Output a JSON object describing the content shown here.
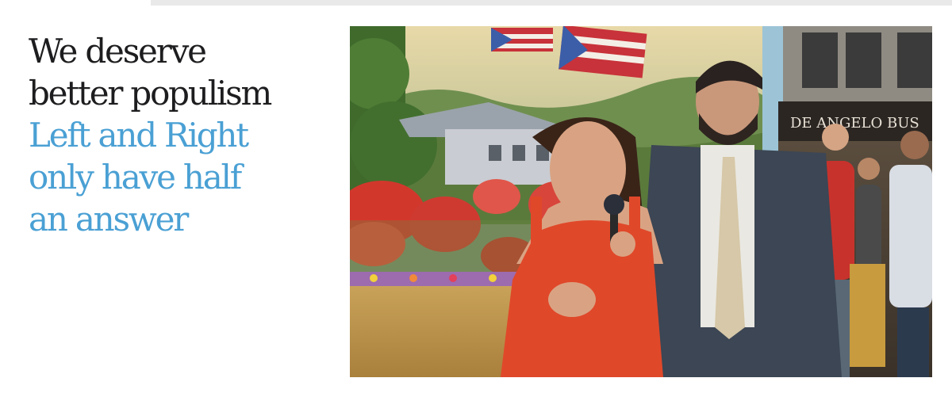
{
  "article": {
    "headline": [
      "We deserve",
      "better populism"
    ],
    "subhead": [
      "Left and Right",
      "only have half",
      "an answer"
    ]
  },
  "hero_image": {
    "sign_text": "DE ANGELO BUS"
  },
  "colors": {
    "headline": "#1d1d1f",
    "subhead_accent": "#4aa0d4",
    "top_bar": "#e9e9e9"
  }
}
